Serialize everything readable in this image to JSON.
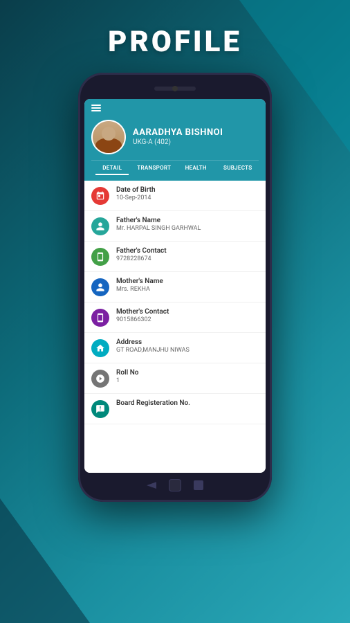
{
  "page": {
    "title": "PROFILE"
  },
  "student": {
    "name": "AARADHYA BISHNOI",
    "class": "UKG-A (402)"
  },
  "tabs": [
    {
      "id": "detail",
      "label": "DETAIL",
      "active": true
    },
    {
      "id": "transport",
      "label": "TRANSPORT",
      "active": false
    },
    {
      "id": "health",
      "label": "HEALTH",
      "active": false
    },
    {
      "id": "subjects",
      "label": "SUBJECTS",
      "active": false
    }
  ],
  "details": [
    {
      "icon": "calendar-icon",
      "iconColor": "icon-red",
      "label": "Date of Birth",
      "value": "10-Sep-2014"
    },
    {
      "icon": "person-icon",
      "iconColor": "icon-teal",
      "label": "Father's Name",
      "value": "Mr. HARPAL SINGH GARHWAL"
    },
    {
      "icon": "phone-icon",
      "iconColor": "icon-green",
      "label": "Father's Contact",
      "value": "9728228674"
    },
    {
      "icon": "person-icon",
      "iconColor": "icon-blue-dark",
      "label": "Mother's Name",
      "value": "Mrs. REKHA"
    },
    {
      "icon": "phone-icon",
      "iconColor": "icon-purple",
      "label": "Mother's Contact",
      "value": "9015866302"
    },
    {
      "icon": "home-icon",
      "iconColor": "icon-cyan",
      "label": "Address",
      "value": "GT ROAD,MANJHU NIWAS"
    },
    {
      "icon": "roll-icon",
      "iconColor": "icon-grey",
      "label": "Roll No",
      "value": "1"
    },
    {
      "icon": "board-icon",
      "iconColor": "icon-teal2",
      "label": "Board Registeration No.",
      "value": ""
    }
  ],
  "hamburger_label": "menu",
  "icons": {
    "calendar": "📅",
    "person": "👤",
    "phone": "📱",
    "home": "🏠",
    "roll": "⚙",
    "board": "📋"
  }
}
